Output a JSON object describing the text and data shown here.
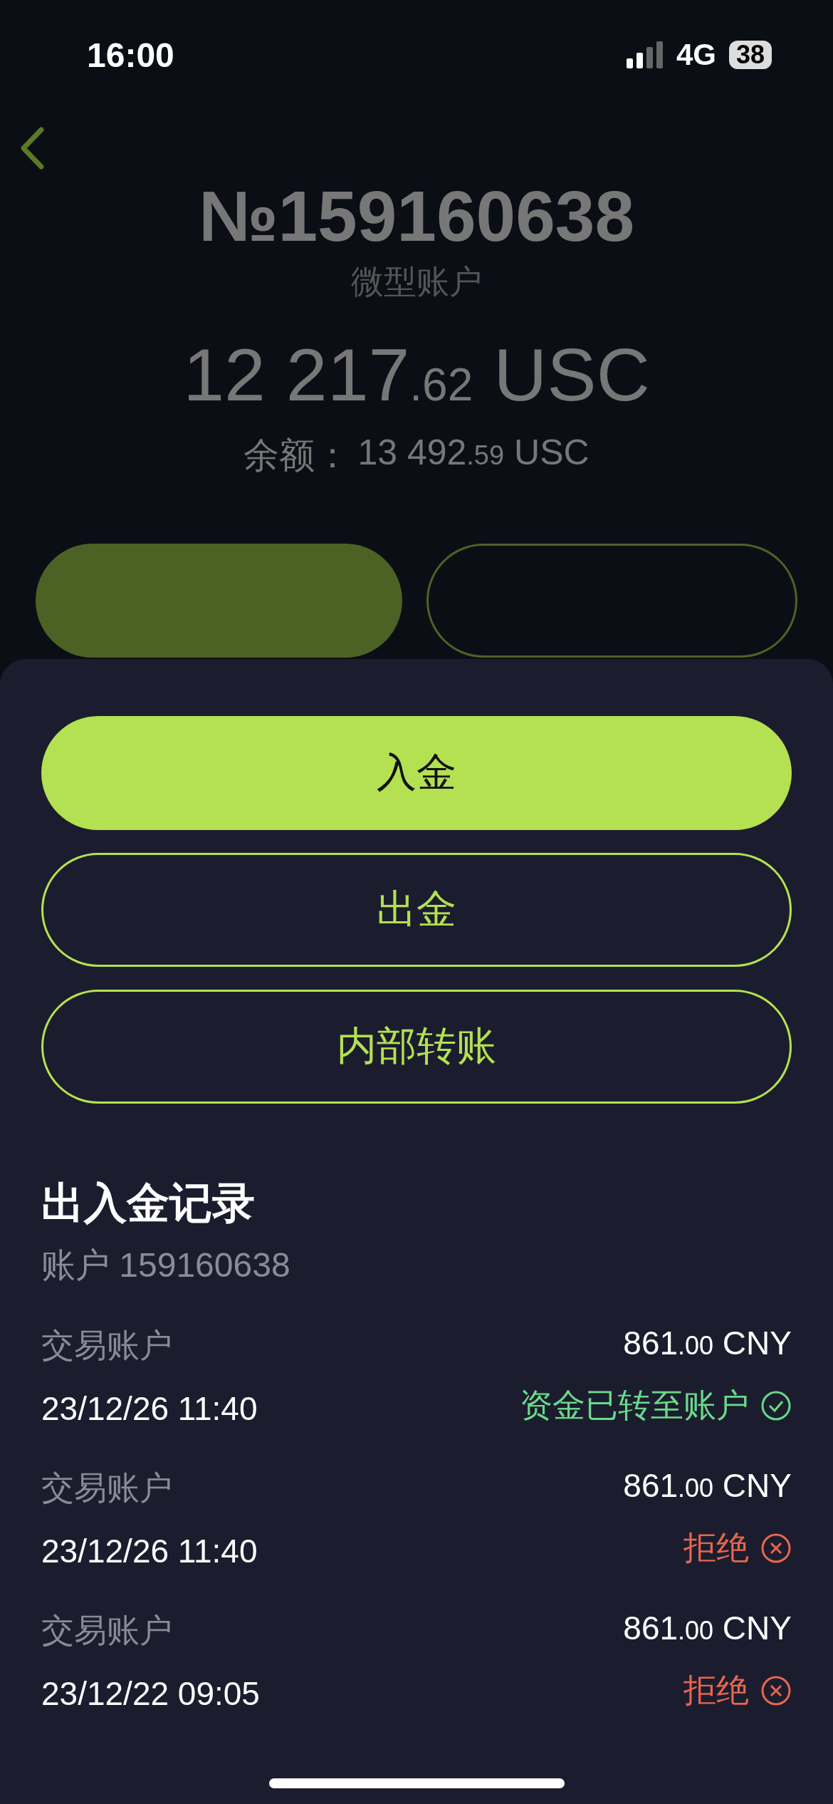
{
  "status_bar": {
    "time": "16:00",
    "network": "4G",
    "battery": "38"
  },
  "account": {
    "number": "№159160638",
    "type": "微型账户",
    "equity": {
      "whole": "12 217",
      "fraction": ".62",
      "currency": "USC"
    },
    "balance": {
      "label": "余额：",
      "whole": "13 492",
      "fraction": ".59",
      "currency": "USC"
    }
  },
  "sheet": {
    "actions": [
      {
        "label": "入金",
        "kind": "primary"
      },
      {
        "label": "出金",
        "kind": "outline"
      },
      {
        "label": "内部转账",
        "kind": "outline"
      }
    ],
    "history": {
      "title": "出入金记录",
      "subtitle": "账户 159160638",
      "records": [
        {
          "account": "交易账户",
          "date": "23/12/26 11:40",
          "whole": "861",
          "fraction": ".00",
          "currency": "CNY",
          "status": "资金已转至账户",
          "kind": "done"
        },
        {
          "account": "交易账户",
          "date": "23/12/26 11:40",
          "whole": "861",
          "fraction": ".00",
          "currency": "CNY",
          "status": "拒绝",
          "kind": "rejected"
        },
        {
          "account": "交易账户",
          "date": "23/12/22 09:05",
          "whole": "861",
          "fraction": ".00",
          "currency": "CNY",
          "status": "拒绝",
          "kind": "rejected"
        }
      ]
    }
  }
}
